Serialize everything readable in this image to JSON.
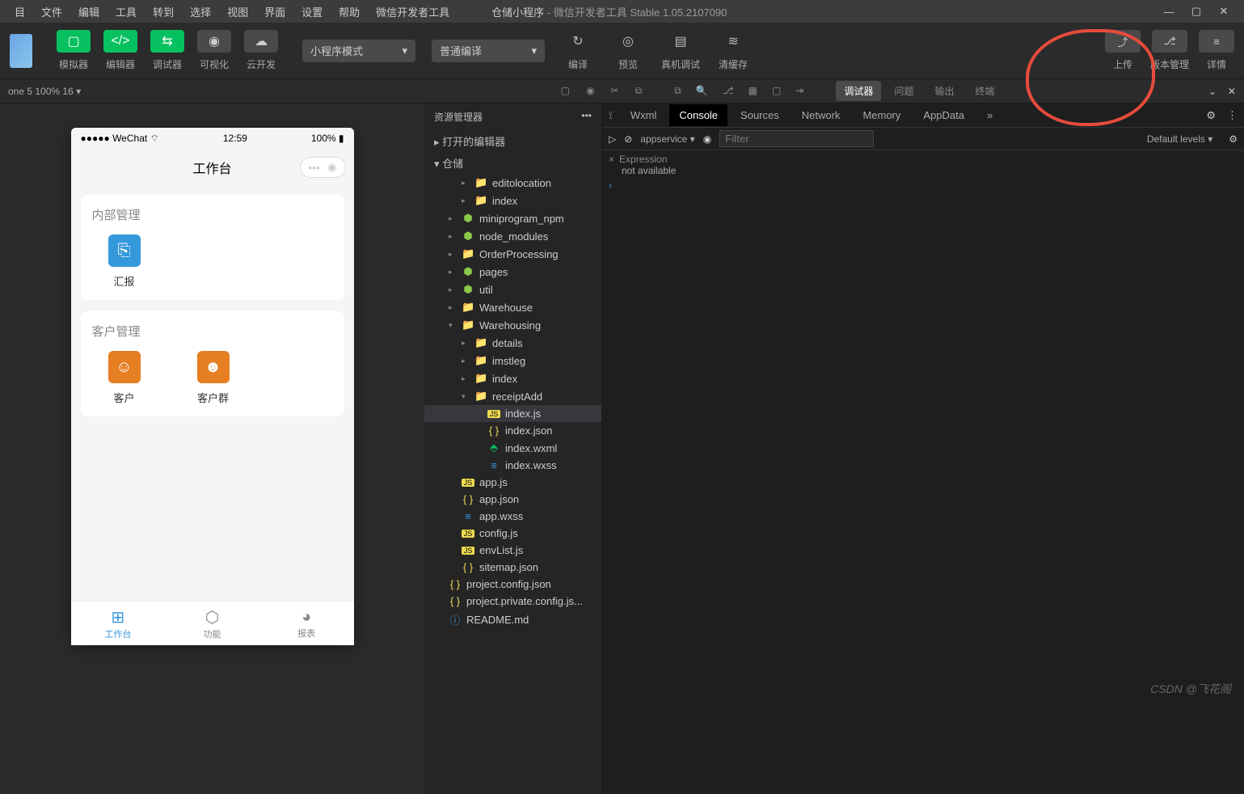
{
  "menubar": {
    "items": [
      "目",
      "文件",
      "编辑",
      "工具",
      "转到",
      "选择",
      "视图",
      "界面",
      "设置",
      "帮助",
      "微信开发者工具"
    ],
    "project_name": "仓储小程序",
    "title_suffix": " - 微信开发者工具 Stable 1.05.2107090"
  },
  "toolbar": {
    "groups": [
      {
        "buttons": [
          "▢"
        ],
        "style": "green",
        "label": "模拟器"
      },
      {
        "buttons": [
          "</>"
        ],
        "style": "green",
        "label": "编辑器"
      },
      {
        "buttons": [
          "⇆"
        ],
        "style": "green",
        "label": "调试器"
      },
      {
        "buttons": [
          "◉"
        ],
        "style": "gray",
        "label": "可视化"
      },
      {
        "buttons": [
          "☁"
        ],
        "style": "gray",
        "label": "云开发"
      }
    ],
    "mode_select": "小程序模式",
    "compile_select": "普通编译",
    "actions": [
      {
        "icon": "↻",
        "label": "编译"
      },
      {
        "icon": "◎",
        "label": "预览"
      },
      {
        "icon": "▤",
        "label": "真机调试"
      },
      {
        "icon": "≋",
        "label": "清缓存"
      }
    ],
    "right": [
      {
        "icon": "⤴",
        "label": "上传"
      },
      {
        "icon": "⎇",
        "label": "版本管理"
      },
      {
        "icon": "≡",
        "label": "详情"
      }
    ]
  },
  "secbar": {
    "device_info": "one 5 100% 16 ▾",
    "mid_icons": [
      "▢",
      "◉",
      "✂",
      "⧉"
    ],
    "dev_tabs": [
      "调试器",
      "问题",
      "输出",
      "终端"
    ],
    "dev_active": 0
  },
  "simulator": {
    "status": {
      "carrier": "●●●●● WeChat",
      "wifi": "⌔",
      "time": "12:59",
      "battery_pct": "100%",
      "battery_icon": "▮"
    },
    "nav_title": "工作台",
    "capsule": {
      "dots": "•••",
      "target": "◉"
    },
    "cards": [
      {
        "title": "内部管理",
        "items": [
          {
            "icon": "⎘",
            "color": "blue",
            "label": "汇报"
          }
        ]
      },
      {
        "title": "客户管理",
        "items": [
          {
            "icon": "☺",
            "color": "orange",
            "label": "客户"
          },
          {
            "icon": "☻",
            "color": "orange",
            "label": "客户群"
          }
        ]
      }
    ],
    "tabbar": [
      {
        "icon": "⊞",
        "label": "工作台",
        "active": true
      },
      {
        "icon": "⬡",
        "label": "功能",
        "active": false
      },
      {
        "icon": "◕",
        "label": "报表",
        "active": false
      }
    ]
  },
  "explorer": {
    "top_icons": [
      "⧉",
      "🔍",
      "⎇",
      "▦",
      "▢",
      "⇥"
    ],
    "title": "资源管理器",
    "sections": {
      "editors": "打开的编辑器",
      "root": "仓储"
    },
    "tree": [
      {
        "depth": 2,
        "arrow": "▸",
        "icon": "folder",
        "name": "editolocation"
      },
      {
        "depth": 2,
        "arrow": "▸",
        "icon": "folder",
        "name": "index"
      },
      {
        "depth": 1,
        "arrow": "▸",
        "icon": "node",
        "name": "miniprogram_npm"
      },
      {
        "depth": 1,
        "arrow": "▸",
        "icon": "node",
        "name": "node_modules"
      },
      {
        "depth": 1,
        "arrow": "▸",
        "icon": "folder",
        "name": "OrderProcessing"
      },
      {
        "depth": 1,
        "arrow": "▸",
        "icon": "node",
        "name": "pages"
      },
      {
        "depth": 1,
        "arrow": "▸",
        "icon": "node",
        "name": "util"
      },
      {
        "depth": 1,
        "arrow": "▸",
        "icon": "folder",
        "name": "Warehouse"
      },
      {
        "depth": 1,
        "arrow": "▾",
        "icon": "folder",
        "name": "Warehousing"
      },
      {
        "depth": 2,
        "arrow": "▸",
        "icon": "folder",
        "name": "details"
      },
      {
        "depth": 2,
        "arrow": "▸",
        "icon": "folder",
        "name": "imstleg"
      },
      {
        "depth": 2,
        "arrow": "▸",
        "icon": "folder",
        "name": "index"
      },
      {
        "depth": 2,
        "arrow": "▾",
        "icon": "folder",
        "name": "receiptAdd"
      },
      {
        "depth": 3,
        "arrow": "",
        "icon": "js",
        "name": "index.js",
        "selected": true
      },
      {
        "depth": 3,
        "arrow": "",
        "icon": "json",
        "name": "index.json"
      },
      {
        "depth": 3,
        "arrow": "",
        "icon": "wxml",
        "name": "index.wxml"
      },
      {
        "depth": 3,
        "arrow": "",
        "icon": "wxss",
        "name": "index.wxss"
      },
      {
        "depth": 1,
        "arrow": "",
        "icon": "js",
        "name": "app.js"
      },
      {
        "depth": 1,
        "arrow": "",
        "icon": "json",
        "name": "app.json"
      },
      {
        "depth": 1,
        "arrow": "",
        "icon": "wxss",
        "name": "app.wxss"
      },
      {
        "depth": 1,
        "arrow": "",
        "icon": "js",
        "name": "config.js"
      },
      {
        "depth": 1,
        "arrow": "",
        "icon": "js",
        "name": "envList.js"
      },
      {
        "depth": 1,
        "arrow": "",
        "icon": "json",
        "name": "sitemap.json"
      },
      {
        "depth": 0,
        "arrow": "",
        "icon": "json",
        "name": "project.config.json"
      },
      {
        "depth": 0,
        "arrow": "",
        "icon": "json",
        "name": "project.private.config.js..."
      },
      {
        "depth": 0,
        "arrow": "",
        "icon": "md",
        "name": "README.md"
      }
    ]
  },
  "devtools": {
    "tabs": [
      "Wxml",
      "Console",
      "Sources",
      "Network",
      "Memory",
      "AppData"
    ],
    "active_tab": 1,
    "more": "»",
    "toolbar": {
      "context": "appservice",
      "filter_placeholder": "Filter",
      "levels": "Default levels ▾"
    },
    "console": {
      "expression_label": "Expression",
      "not_available": "not available",
      "prompt": "›"
    },
    "gear_icon": "⚙",
    "more_icon": "⋮"
  },
  "watermark": "CSDN @飞花阁"
}
